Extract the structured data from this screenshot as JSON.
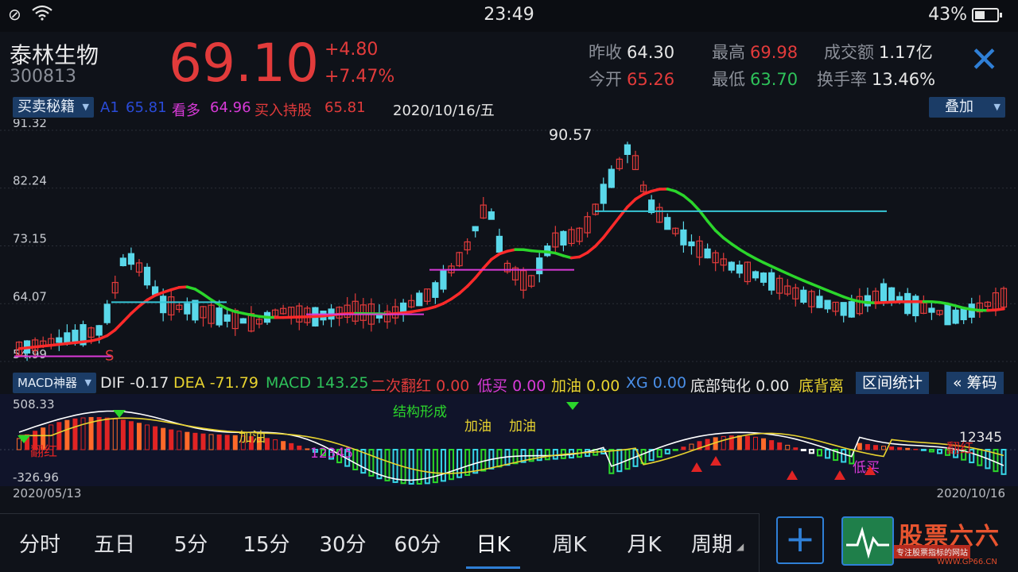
{
  "status": {
    "time": "23:49",
    "battery": "43%"
  },
  "stock": {
    "name": "泰林生物",
    "code": "300813",
    "price": "69.10",
    "change": "+4.80",
    "change_pct": "+7.47%",
    "prev_close_label": "昨收",
    "prev_close": "64.30",
    "open_label": "今开",
    "open": "65.26",
    "high_label": "最高",
    "high": "69.98",
    "low_label": "最低",
    "low": "63.70",
    "amount_label": "成交额",
    "amount": "1.17亿",
    "turnover_label": "换手率",
    "turnover": "13.46%"
  },
  "indicator": {
    "selector": "买卖秘籍",
    "a1_label": "A1",
    "a1_value": "65.81",
    "bull_label": "看多",
    "bull_value": "64.96",
    "hold_label": "买入持股",
    "hold_value": "65.81",
    "date": "2020/10/16/五",
    "overlay": "叠加"
  },
  "price_axis": [
    "91.32",
    "82.24",
    "73.15",
    "64.07",
    "54.99"
  ],
  "chart_labels": {
    "peak": "90.57",
    "sell_mark": "S"
  },
  "macd": {
    "selector": "MACD神器",
    "dif_label": "DIF",
    "dif": "-0.17",
    "dea_label": "DEA",
    "dea": "-71.79",
    "macd_label": "MACD",
    "macd": "143.25",
    "twice_red_label": "二次翻红",
    "twice_red": "0.00",
    "low_buy_label": "低买",
    "low_buy": "0.00",
    "refuel_label": "加油",
    "refuel": "0.00",
    "xg_label": "XG",
    "xg": "0.00",
    "bottom_label": "底部钝化",
    "bottom": "0.00",
    "divergence_label": "底背离",
    "range_stats": "区间统计",
    "chips": "« 筹码",
    "axis_top": "508.33",
    "axis_bottom": "-326.96",
    "annotations": {
      "struct": "结构形成",
      "add1": "加油",
      "add2": "加油",
      "add3": "加油",
      "flip": "翻红",
      "lowbuy": "低买",
      "flip2": "翻红",
      "seq1": "12345",
      "seq2": "12345"
    }
  },
  "dates": {
    "start": "2020/05/13",
    "end": "2020/10/16"
  },
  "tabs": [
    "分时",
    "五日",
    "5分",
    "15分",
    "30分",
    "60分",
    "日K",
    "周K",
    "月K",
    "周期"
  ],
  "active_tab": "日K",
  "watermark": {
    "title": "股票六六",
    "subtitle": "专注股票指标的网站",
    "url": "WWW.GP66.CN"
  },
  "chart_data": {
    "type": "candlestick",
    "ylim": [
      54.99,
      91.32
    ],
    "peak_value": 90.57,
    "candles": []
  },
  "colors": {
    "up": "#e23b3b",
    "down": "#5ad8ea",
    "accent": "#2f7fd6"
  }
}
